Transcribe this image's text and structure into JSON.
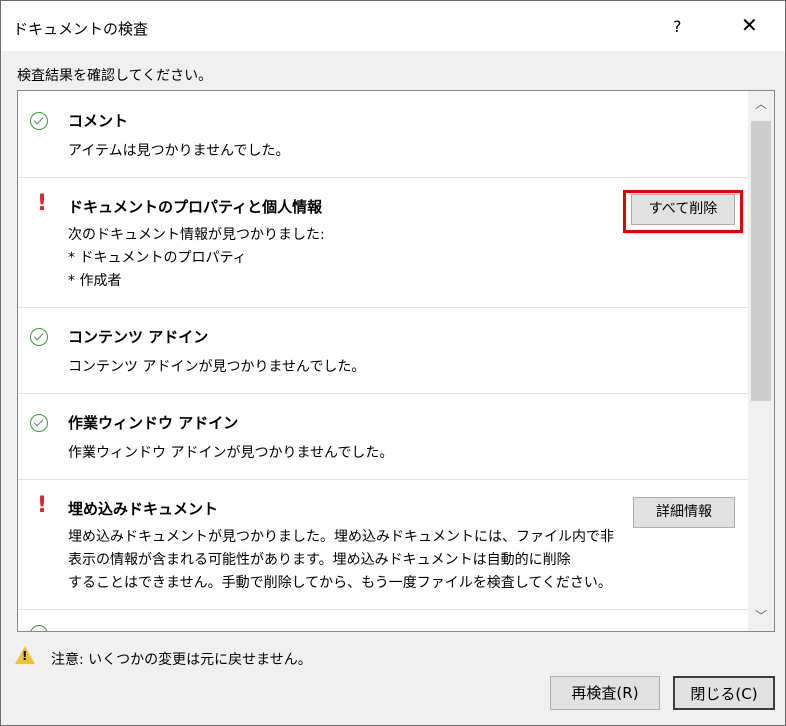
{
  "window": {
    "title": "ドキュメントの検査",
    "help": "?",
    "close": "✕"
  },
  "instruction": "検査結果を確認してください。",
  "sections": [
    {
      "status": "ok",
      "title": "コメント",
      "lines": [
        "アイテムは見つかりませんでした。"
      ]
    },
    {
      "status": "warning",
      "title": "ドキュメントのプロパティと個人情報",
      "lines": [
        "次のドキュメント情報が見つかりました:",
        "* ドキュメントのプロパティ",
        "* 作成者"
      ],
      "button": "すべて削除"
    },
    {
      "status": "ok",
      "title": "コンテンツ アドイン",
      "lines": [
        "コンテンツ アドインが見つかりませんでした。"
      ]
    },
    {
      "status": "ok",
      "title": "作業ウィンドウ アドイン",
      "lines": [
        "作業ウィンドウ アドインが見つかりませんでした。"
      ]
    },
    {
      "status": "warning",
      "title": "埋め込みドキュメント",
      "lines": [
        "埋め込みドキュメントが見つかりました。埋め込みドキュメントには、ファイル内で非",
        "表示の情報が含まれる可能性があります。埋め込みドキュメントは自動的に削除",
        "することはできません。手動で削除してから、もう一度ファイルを検査してください。"
      ],
      "button": "詳細情報"
    }
  ],
  "note": "注意: いくつかの変更は元に戻せません。",
  "footer": {
    "reinspect": "再検査(R)",
    "close": "閉じる(C)"
  },
  "colors": {
    "ok": "#3a9b3a",
    "warning": "#e0202a",
    "highlight": "#e00000"
  }
}
